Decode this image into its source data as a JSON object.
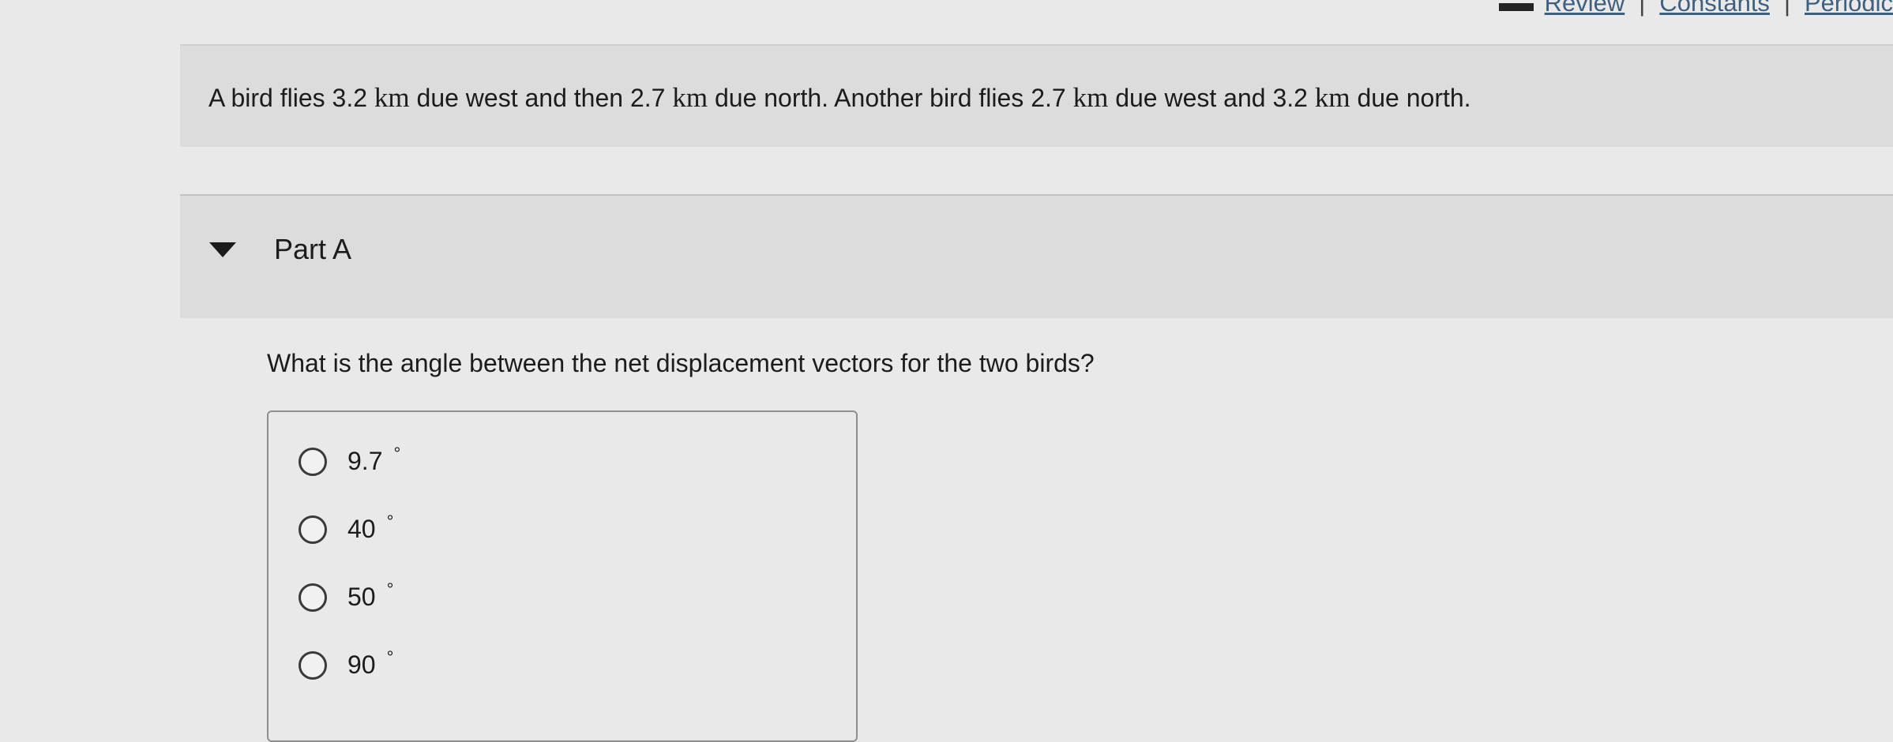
{
  "top_links": {
    "review": "Review",
    "constants": "Constants",
    "periodic": "Periodic",
    "separator": "|"
  },
  "problem": {
    "intro_parts": [
      "A bird flies 3.2 ",
      "km",
      " due west and then 2.7 ",
      "km",
      " due north. Another bird flies 2.7 ",
      "km",
      " due west and 3.2 ",
      "km",
      " due north."
    ]
  },
  "part": {
    "title": "Part A",
    "question": "What is the angle between the net displacement vectors for the two birds?",
    "options": [
      {
        "value": "9.7",
        "unit": "°"
      },
      {
        "value": "40",
        "unit": "°"
      },
      {
        "value": "50",
        "unit": "°"
      },
      {
        "value": "90",
        "unit": "°"
      }
    ]
  },
  "colors": {
    "background": "#e9e9e9",
    "panel": "#dcdcdc",
    "link": "#3f5f7f",
    "text": "#1c1c1c"
  }
}
